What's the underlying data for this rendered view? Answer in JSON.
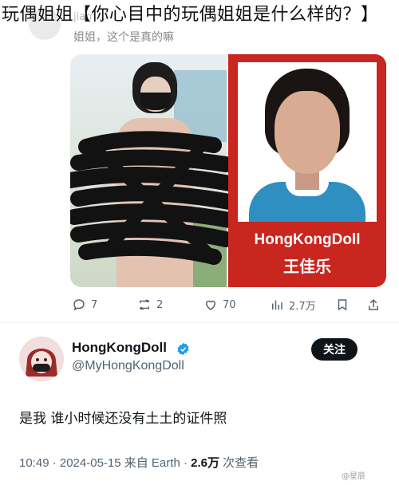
{
  "headline": "玩偶姐姐【你心目中的玩偶姐姐是什么样的？】",
  "top_post": {
    "handle_partial": "jiam...",
    "text": "姐姐，这个是真的嘛",
    "image_label_en": "HongKongDoll",
    "image_label_cn": "王佳乐"
  },
  "actions": {
    "replies": "7",
    "retweets": "2",
    "likes": "70",
    "views": "2.7万"
  },
  "reply_post": {
    "display_name": "HongKongDoll",
    "handle": "@MyHongKongDoll",
    "follow_label": "关注",
    "text": "是我 谁小时候还没有土土的证件照",
    "time": "10:49 · 2024-05-15 来自 Earth · ",
    "views": "2.6万",
    "views_suffix": " 次查看"
  },
  "watermark": "@星辰"
}
